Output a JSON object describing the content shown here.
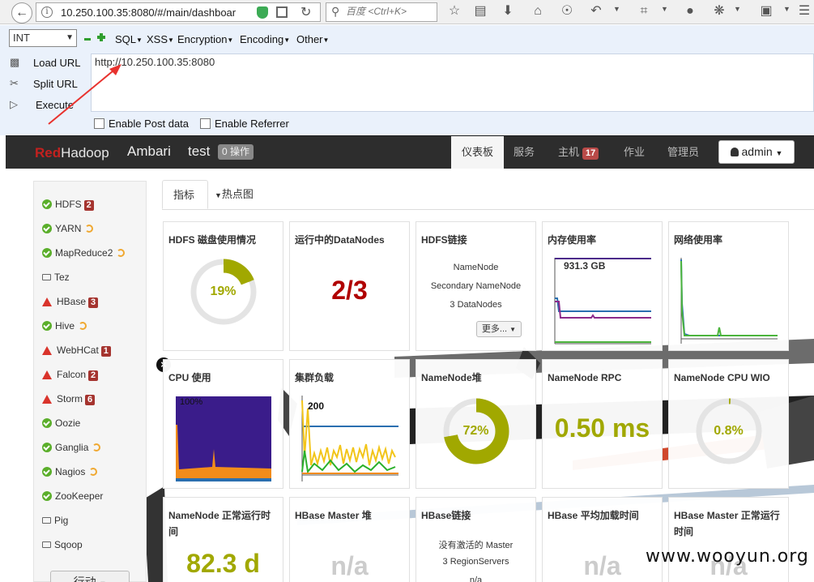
{
  "browser": {
    "url": "10.250.100.35:8080/#/main/dashboar",
    "search_placeholder": "百度 <Ctrl+K>"
  },
  "hackbar": {
    "type_select": "INT",
    "menus": [
      "SQL",
      "XSS",
      "Encryption",
      "Encoding",
      "Other"
    ],
    "side_buttons": [
      "Load URL",
      "Split URL",
      "Execute"
    ],
    "textarea_value": "http://10.250.100.35:8080",
    "checkboxes": [
      "Enable Post data",
      "Enable Referrer"
    ]
  },
  "navbar": {
    "brand_red": "Red",
    "brand_white": "Hadoop",
    "app_name": "Ambari",
    "cluster_name": "test",
    "ops_badge": "0 操作",
    "tabs": [
      {
        "label": "仪表板"
      },
      {
        "label": "服务"
      },
      {
        "label": "主机",
        "badge": "17"
      },
      {
        "label": "作业"
      },
      {
        "label": "管理员"
      }
    ],
    "user": "admin"
  },
  "sidebar": {
    "services": [
      {
        "name": "HDFS",
        "status": "ok",
        "badge": "2"
      },
      {
        "name": "YARN",
        "status": "ok",
        "spin": true
      },
      {
        "name": "MapReduce2",
        "status": "ok",
        "spin": true
      },
      {
        "name": "Tez",
        "status": "client"
      },
      {
        "name": "HBase",
        "status": "alert",
        "badge": "3"
      },
      {
        "name": "Hive",
        "status": "ok",
        "spin": true
      },
      {
        "name": "WebHCat",
        "status": "alert",
        "badge": "1"
      },
      {
        "name": "Falcon",
        "status": "alert",
        "badge": "2"
      },
      {
        "name": "Storm",
        "status": "alert",
        "badge": "6"
      },
      {
        "name": "Oozie",
        "status": "ok"
      },
      {
        "name": "Ganglia",
        "status": "ok",
        "spin": true
      },
      {
        "name": "Nagios",
        "status": "ok",
        "spin": true
      },
      {
        "name": "ZooKeeper",
        "status": "ok"
      },
      {
        "name": "Pig",
        "status": "client"
      },
      {
        "name": "Sqoop",
        "status": "client"
      }
    ],
    "actions_label": "行动"
  },
  "dashboard_tabs": [
    "指标",
    "热点图"
  ],
  "widgets": {
    "hdfs_disk": {
      "title": "HDFS 磁盘使用情况",
      "value": "19%",
      "fraction": 0.19,
      "color": "#a1a800"
    },
    "datanodes": {
      "title": "运行中的DataNodes",
      "value": "2/3"
    },
    "hdfs_links": {
      "title": "HDFS链接",
      "lines": [
        "NameNode",
        "Secondary NameNode",
        "3 DataNodes"
      ],
      "more": "更多..."
    },
    "memory": {
      "title": "内存使用率",
      "value": "931.3 GB"
    },
    "network": {
      "title": "网络使用率"
    },
    "cpu": {
      "title": "CPU 使用",
      "value": "100%"
    },
    "cluster_load": {
      "title": "集群负载",
      "value": "200"
    },
    "namenode_heap": {
      "title": "NameNode堆",
      "value": "72%",
      "fraction": 0.72,
      "color": "#a1a800"
    },
    "namenode_rpc": {
      "title": "NameNode RPC",
      "value": "0.50 ms"
    },
    "namenode_cpu": {
      "title": "NameNode CPU WIO",
      "value": "0.8%",
      "fraction": 0.008,
      "color": "#a1a800"
    },
    "namenode_uptime": {
      "title": "NameNode 正常运行时间",
      "value": "82.3 d"
    },
    "hbase_heap": {
      "title": "HBase Master 堆",
      "value": "n/a"
    },
    "hbase_links": {
      "title": "HBase链接",
      "lines": [
        "没有激活的 Master",
        "3 RegionServers",
        "n/a"
      ]
    },
    "hbase_load": {
      "title": "HBase 平均加载时间",
      "value": "n/a"
    },
    "hbase_uptime": {
      "title": "HBase Master 正常运行时间",
      "value": "n/a"
    }
  },
  "watermark": "www.wooyun.org"
}
